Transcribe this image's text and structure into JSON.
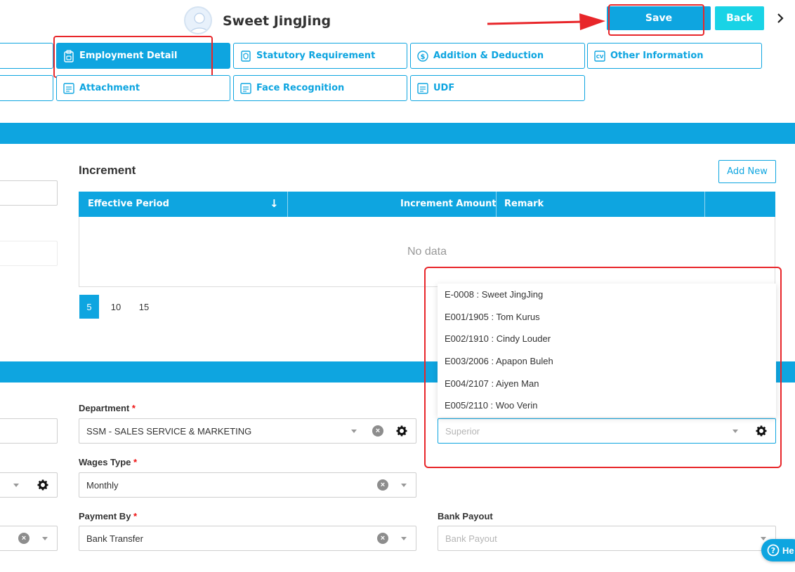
{
  "header": {
    "employee_name": "Sweet JingJing",
    "save_label": "Save",
    "back_label": "Back"
  },
  "tabs": {
    "row1": [
      {
        "label": "Employment Detail",
        "icon": "clipboard-icon",
        "active": true
      },
      {
        "label": "Statutory Requirement",
        "icon": "shield-icon"
      },
      {
        "label": "Addition & Deduction",
        "icon": "dollar-icon"
      },
      {
        "label": "Other Information",
        "icon": "cv-icon"
      }
    ],
    "row2": [
      {
        "label": "Attachment",
        "icon": "document-icon"
      },
      {
        "label": "Face Recognition",
        "icon": "document-icon"
      },
      {
        "label": "UDF",
        "icon": "document-icon"
      }
    ]
  },
  "increment": {
    "title": "Increment",
    "add_new_label": "Add New",
    "columns": [
      "Effective Period",
      "Increment Amount",
      "Remark"
    ],
    "sort_indicator": "↓",
    "empty_text": "No data",
    "page_sizes": [
      "5",
      "10",
      "15"
    ],
    "selected_page_size": "5"
  },
  "form": {
    "department": {
      "label": "Department",
      "value": "SSM - SALES SERVICE & MARKETING"
    },
    "wages_type": {
      "label": "Wages Type",
      "value": "Monthly"
    },
    "payment_by": {
      "label": "Payment By",
      "value": "Bank Transfer"
    },
    "bank_payout": {
      "label": "Bank Payout",
      "placeholder": "Bank Payout"
    },
    "superior": {
      "placeholder": "Superior"
    }
  },
  "superior_options": [
    "E-0008 : Sweet JingJing",
    "E001/1905 : Tom Kurus",
    "E002/1910 : Cindy Louder",
    "E003/2006 : Apapon Buleh",
    "E004/2107 : Aiyen Man",
    "E005/2110 : Woo Verin"
  ],
  "help": {
    "label": "He"
  },
  "colors": {
    "primary": "#0ea5e0",
    "back": "#19d3e6",
    "highlight": "#e8262a"
  }
}
